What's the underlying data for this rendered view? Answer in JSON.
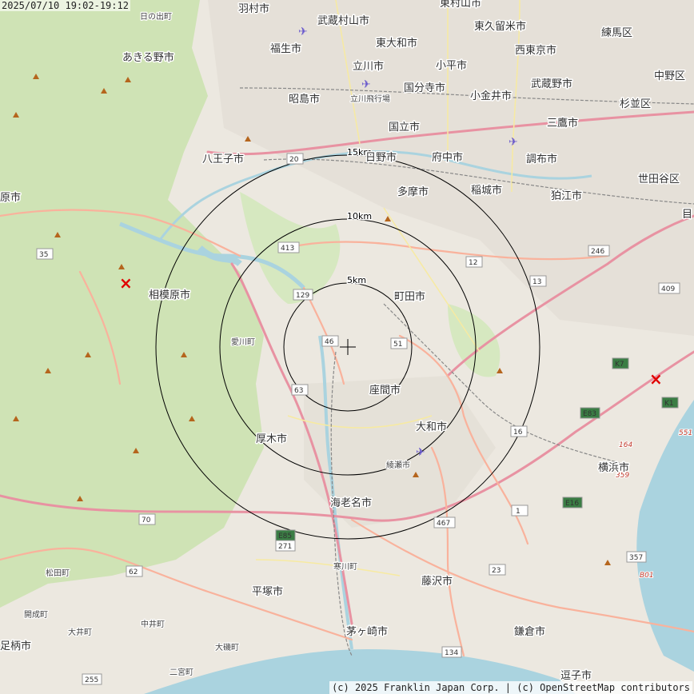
{
  "header": {
    "timestamp": "2025/07/10 19:02-19:12"
  },
  "footer": {
    "credit": "(c) 2025 Franklin Japan Corp. | (c) OpenStreetMap contributors"
  },
  "rings": {
    "r5": "5km",
    "r10": "10km",
    "r15": "15km"
  },
  "colors": {
    "forest": "#cfe3b5",
    "urban": "#e8e4dc",
    "sea": "#aad3df",
    "motorway": "#e892a2",
    "trunk": "#f9b29c",
    "ring": "#000000",
    "marker": "#e00000"
  },
  "places": {
    "hamura": "羽村市",
    "musashimurayama": "武蔵村山市",
    "higashimurayama": "東村山市",
    "hinode": "日の出町",
    "higashiyamato": "東大和市",
    "higashikurume": "東久留米市",
    "nerima": "練馬区",
    "akiruno": "あきる野市",
    "fussa": "福生市",
    "nishitokyo": "西東京市",
    "tachikawa": "立川市",
    "kodaira": "小平市",
    "kokubunji": "国分寺市",
    "musashino": "武蔵野市",
    "nakano": "中野区",
    "tachikawa_airfield": "立川飛行場",
    "akishima": "昭島市",
    "koganei": "小金井市",
    "suginami": "杉並区",
    "kunitachi": "国立市",
    "mitaka": "三鷹市",
    "hachioji": "八王子市",
    "hino": "日野市",
    "fuchu": "府中市",
    "chofu": "調布市",
    "setagaya": "世田谷区",
    "hara": "原市",
    "tama": "多摩市",
    "inagi": "稲城市",
    "komae": "狛江市",
    "meguro": "目",
    "machida": "町田市",
    "sagamihara": "相模原市",
    "aikawa": "愛川町",
    "zama": "座間市",
    "atsugi": "厚木市",
    "yamato": "大和市",
    "ayase": "綾瀬市",
    "yokohama": "横浜市",
    "ebina": "海老名市",
    "samukawa": "寒川町",
    "matsuda": "松田町",
    "hiratsuka": "平塚市",
    "fujisawa": "藤沢市",
    "kaisei": "開成町",
    "oi": "大井町",
    "nakai": "中井町",
    "chigasaki": "茅ヶ崎市",
    "kamakura": "鎌倉市",
    "ashigara": "足柄市",
    "oiso": "大磯町",
    "ninomiya": "二宮町",
    "zushi": "逗子市"
  },
  "routes": [
    "20",
    "35",
    "413",
    "129",
    "46",
    "51",
    "12",
    "13",
    "246",
    "409",
    "63",
    "16",
    "1",
    "467",
    "23",
    "70",
    "62",
    "271",
    "E85",
    "E83",
    "E16",
    "357",
    "359",
    "K1",
    "K7",
    "134",
    "255",
    "B01",
    "164",
    "551"
  ],
  "markers": [
    {
      "name": "epicenter-marker-west",
      "symbol": "×"
    },
    {
      "name": "epicenter-marker-east",
      "symbol": "×"
    }
  ]
}
